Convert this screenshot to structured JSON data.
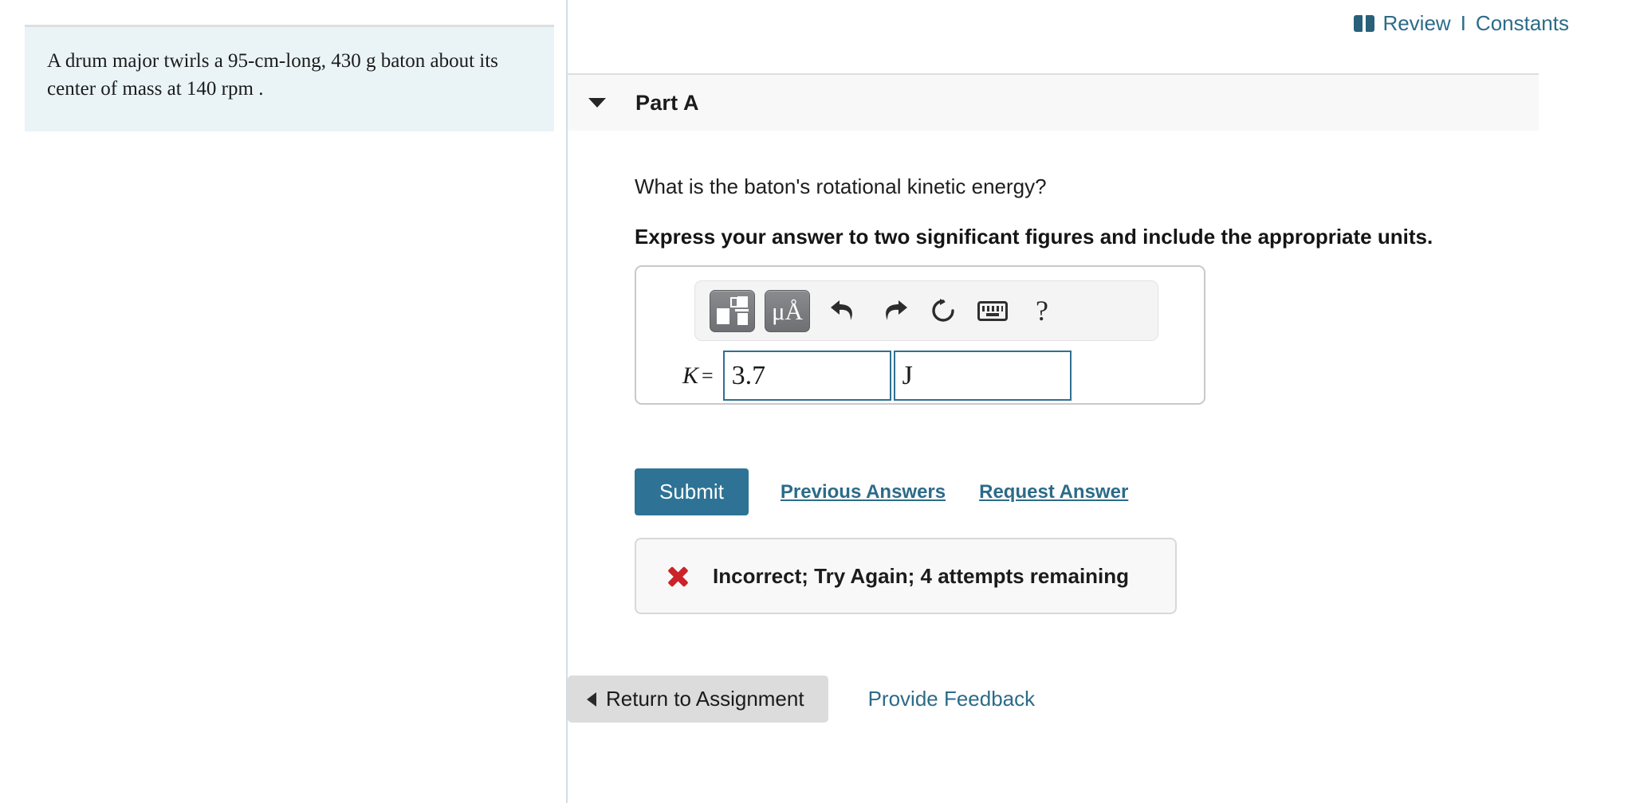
{
  "problem": {
    "statement": "A drum major twirls a 95-cm-long, 430 g baton about its center of mass at 140 rpm ."
  },
  "header": {
    "book_icon": "book-icon",
    "review_label": "Review",
    "separator": "I",
    "constants_label": "Constants"
  },
  "part": {
    "caret_icon": "chevron-down-icon",
    "title": "Part A",
    "question": "What is the baton's rotational kinetic energy?",
    "instruction": "Express your answer to two significant figures and include the appropriate units."
  },
  "answer": {
    "toolbar": {
      "template_button_icon": "math-template-icon",
      "units_button_label": "μÅ",
      "undo_icon": "undo-arrow-icon",
      "redo_icon": "redo-arrow-icon",
      "reset_icon": "reset-circular-arrow-icon",
      "keyboard_icon": "keyboard-icon",
      "help_label": "?"
    },
    "variable_label": "K",
    "equals": "=",
    "value": "3.7",
    "units": "J",
    "value_placeholder": "",
    "units_placeholder": ""
  },
  "actions": {
    "submit_label": "Submit",
    "previous_answers_label": "Previous Answers",
    "request_answer_label": "Request Answer"
  },
  "feedback": {
    "status_icon": "error-x-icon",
    "message": "Incorrect; Try Again; 4 attempts remaining"
  },
  "footer": {
    "back_icon": "chevron-left-icon",
    "return_label": "Return to Assignment",
    "provide_feedback_label": "Provide Feedback"
  },
  "colors": {
    "accent_teal": "#2e7395",
    "link_teal": "#2c6b89",
    "error_red": "#cc2229",
    "problem_bg": "#eaf4f7",
    "panel_bg": "#f8f8f8"
  }
}
